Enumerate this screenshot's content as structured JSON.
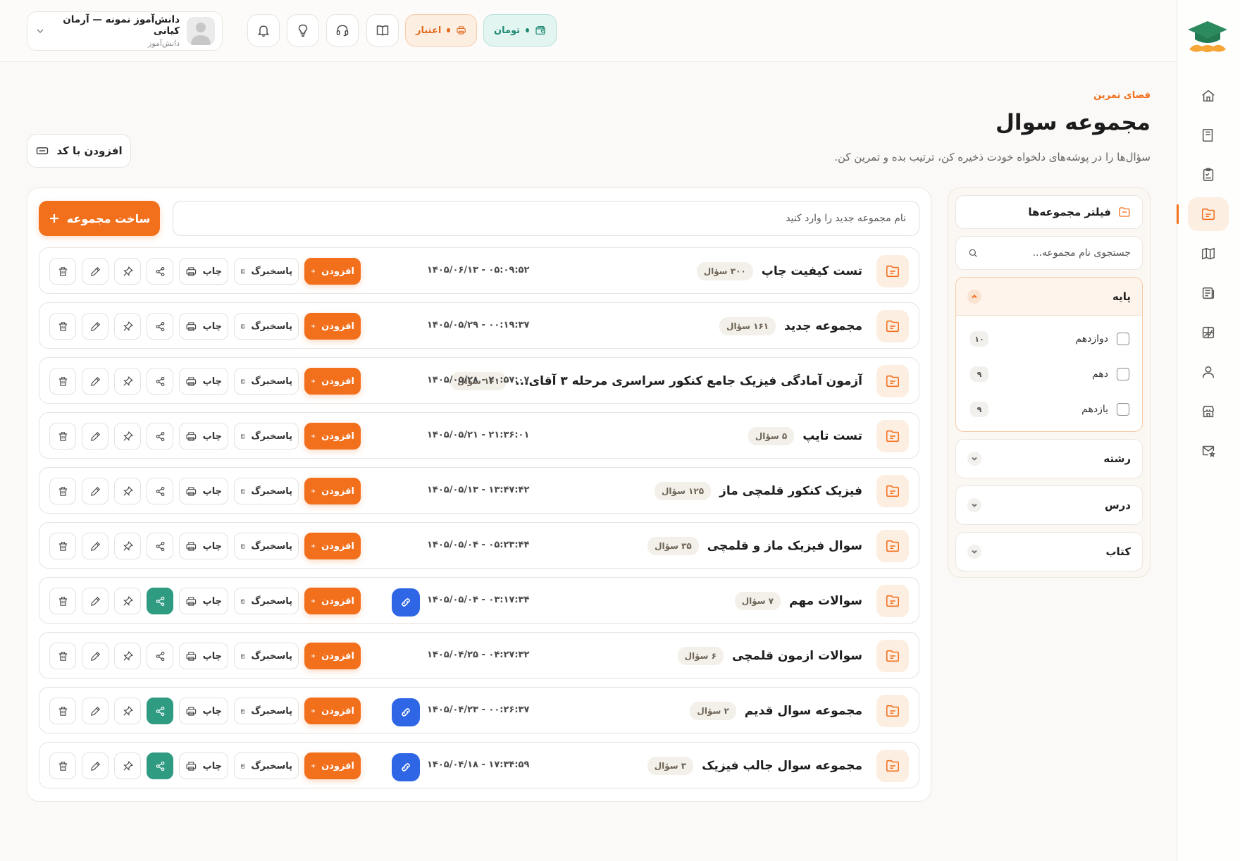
{
  "header": {
    "user_name": "دانش‌آموز نمونه — آرمان کیانی",
    "user_role": "دانش‌آموز",
    "credit_label": "اعتبار",
    "toman_label": "تومان"
  },
  "page": {
    "breadcrumb": "فضای تمرین",
    "title": "مجموعه سوال",
    "description": "سؤال‌ها را در پوشه‌های دلخواه خودت ذخیره کن، ترتیب بده و تمرین کن.",
    "add_by_code": "افزودن با کد"
  },
  "filter": {
    "title": "فیلتر مجموعه‌ها",
    "search_placeholder": "جستجوی نام مجموعه...",
    "groups": [
      {
        "label": "پایه",
        "options": [
          {
            "label": "دوازدهم",
            "count": "۱۰"
          },
          {
            "label": "دهم",
            "count": "۹"
          },
          {
            "label": "یازدهم",
            "count": "۹"
          }
        ]
      },
      {
        "label": "رشته"
      },
      {
        "label": "درس"
      },
      {
        "label": "کتاب"
      }
    ]
  },
  "create": {
    "placeholder": "نام مجموعه جدید را وارد کنید",
    "button": "ساخت مجموعه"
  },
  "actions": {
    "add": "افزودن",
    "answer": "پاسخبرگ",
    "print": "چاپ"
  },
  "collections": [
    {
      "title": "تست کیفیت چاپ",
      "count": "۳۰۰ سؤال",
      "date": "۱۴۰۵/۰۶/۱۳ - ۰۵:۰۹:۵۲",
      "shared": false
    },
    {
      "title": "مجموعه جدید",
      "count": "۱۶۱ سؤال",
      "date": "۱۴۰۵/۰۵/۲۹ - ۰۰:۱۹:۳۷",
      "shared": false
    },
    {
      "title": "آزمون آمادگی فیزیک جامع کنکور سراسری مرحله ۳ آقای...",
      "count": "۱۶۱ سؤال",
      "date": "۱۴۰۵/۰۵/۲۸ - ۲۰:۵۷:۰۷",
      "shared": false
    },
    {
      "title": "تست تایپ",
      "count": "۵ سؤال",
      "date": "۱۴۰۵/۰۵/۲۱ - ۲۱:۳۶:۰۱",
      "shared": false
    },
    {
      "title": "فیزیک کنکور قلمچی ماز",
      "count": "۱۲۵ سؤال",
      "date": "۱۴۰۵/۰۵/۱۳ - ۱۳:۴۷:۴۲",
      "shared": false
    },
    {
      "title": "سوال فیزیک ماز و قلمچی",
      "count": "۳۵ سؤال",
      "date": "۱۴۰۵/۰۵/۰۴ - ۰۵:۲۳:۴۴",
      "shared": false
    },
    {
      "title": "سوالات مهم",
      "count": "۷ سؤال",
      "date": "۱۴۰۵/۰۵/۰۴ - ۰۳:۱۷:۳۴",
      "shared": true
    },
    {
      "title": "سوالات ازمون قلمچی",
      "count": "۶ سؤال",
      "date": "۱۴۰۵/۰۴/۲۵ - ۰۴:۲۷:۳۲",
      "shared": false
    },
    {
      "title": "مجموعه سوال قدیم",
      "count": "۲ سؤال",
      "date": "۱۴۰۵/۰۴/۲۳ - ۰۰:۲۶:۳۷",
      "shared": true
    },
    {
      "title": "مجموعه سوال جالب فیزیک",
      "count": "۳ سؤال",
      "date": "۱۴۰۵/۰۴/۱۸ - ۱۷:۳۴:۵۹",
      "shared": true
    }
  ],
  "colors": {
    "accent": "#f26f1c",
    "share_active": "#2f9b80",
    "link": "#2e66e6",
    "toman": "#1f8a72"
  },
  "icons": {
    "rail": [
      "home-icon",
      "book-icon",
      "clipboard-check-icon",
      "folder-icon",
      "map-icon",
      "newspaper-icon",
      "chart-grid-icon",
      "user-icon",
      "store-icon",
      "mail-star-icon"
    ]
  }
}
